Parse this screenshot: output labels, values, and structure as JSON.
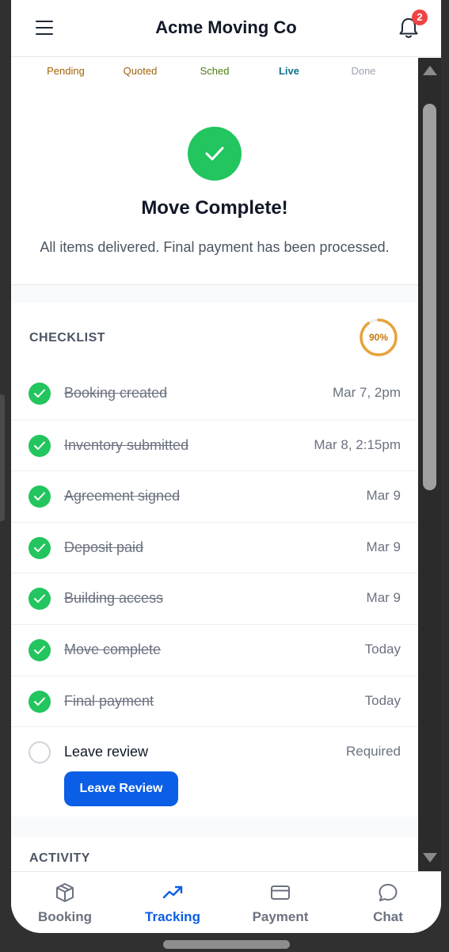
{
  "header": {
    "title": "Acme Moving Co",
    "notification_count": "2"
  },
  "status_tabs": [
    {
      "label": "Pending",
      "color": "#a16207"
    },
    {
      "label": "Quoted",
      "color": "#a16207"
    },
    {
      "label": "Sched",
      "color": "#4d7c0f"
    },
    {
      "label": "Live",
      "color": "#0e7490"
    },
    {
      "label": "Done",
      "color": "#9ca3af"
    }
  ],
  "completion": {
    "title": "Move Complete!",
    "subtitle": "All items delivered. Final payment has been processed."
  },
  "checklist": {
    "label": "CHECKLIST",
    "progress_text": "90%",
    "progress": 0.9,
    "items": [
      {
        "label": "Booking created",
        "date": "Mar 7, 2pm",
        "done": true
      },
      {
        "label": "Inventory submitted",
        "date": "Mar 8, 2:15pm",
        "done": true
      },
      {
        "label": "Agreement signed",
        "date": "Mar 9",
        "done": true
      },
      {
        "label": "Deposit paid",
        "date": "Mar 9",
        "done": true
      },
      {
        "label": "Building access",
        "date": "Mar 9",
        "done": true
      },
      {
        "label": "Move complete",
        "date": "Today",
        "done": true
      },
      {
        "label": "Final payment",
        "date": "Today",
        "done": true
      }
    ],
    "review": {
      "label": "Leave review",
      "status": "Required",
      "button": "Leave Review"
    }
  },
  "activity": {
    "label": "ACTIVITY"
  },
  "bottom_nav": [
    {
      "label": "Booking",
      "icon": "box-icon",
      "active": false
    },
    {
      "label": "Tracking",
      "icon": "trend-icon",
      "active": true
    },
    {
      "label": "Payment",
      "icon": "card-icon",
      "active": false
    },
    {
      "label": "Chat",
      "icon": "chat-bubble-icon",
      "active": false
    }
  ],
  "colors": {
    "accent": "#0b5ee6",
    "success": "#22c55e",
    "badge": "#ef4444",
    "progress": "#e8a23a"
  }
}
